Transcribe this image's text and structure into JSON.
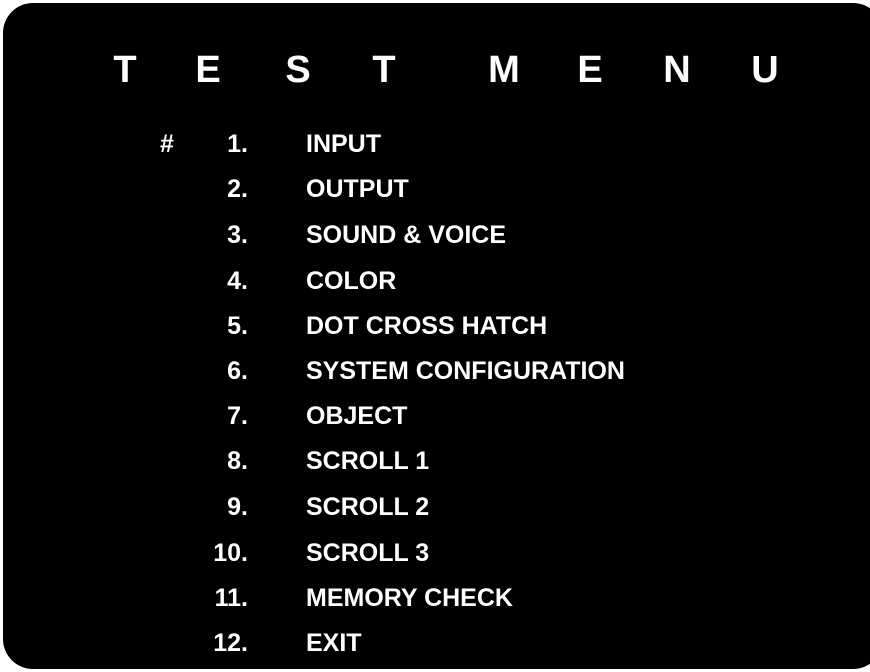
{
  "title": {
    "letters": [
      "T",
      "E",
      "S",
      "T",
      "M",
      "E",
      "N",
      "U"
    ]
  },
  "menu": {
    "cursor": "#",
    "selected_index": 0,
    "items": [
      {
        "number": "1.",
        "label": "INPUT"
      },
      {
        "number": "2.",
        "label": "OUTPUT"
      },
      {
        "number": "3.",
        "label": "SOUND & VOICE"
      },
      {
        "number": "4.",
        "label": "COLOR"
      },
      {
        "number": "5.",
        "label": "DOT CROSS HATCH"
      },
      {
        "number": "6.",
        "label": "SYSTEM CONFIGURATION"
      },
      {
        "number": "7.",
        "label": "OBJECT"
      },
      {
        "number": "8.",
        "label": "SCROLL 1"
      },
      {
        "number": "9.",
        "label": "SCROLL 2"
      },
      {
        "number": "10.",
        "label": "SCROLL 3"
      },
      {
        "number": "11.",
        "label": "MEMORY CHECK"
      },
      {
        "number": "12.",
        "label": "EXIT"
      }
    ]
  },
  "colors": {
    "background": "#000000",
    "text": "#ffffff"
  }
}
